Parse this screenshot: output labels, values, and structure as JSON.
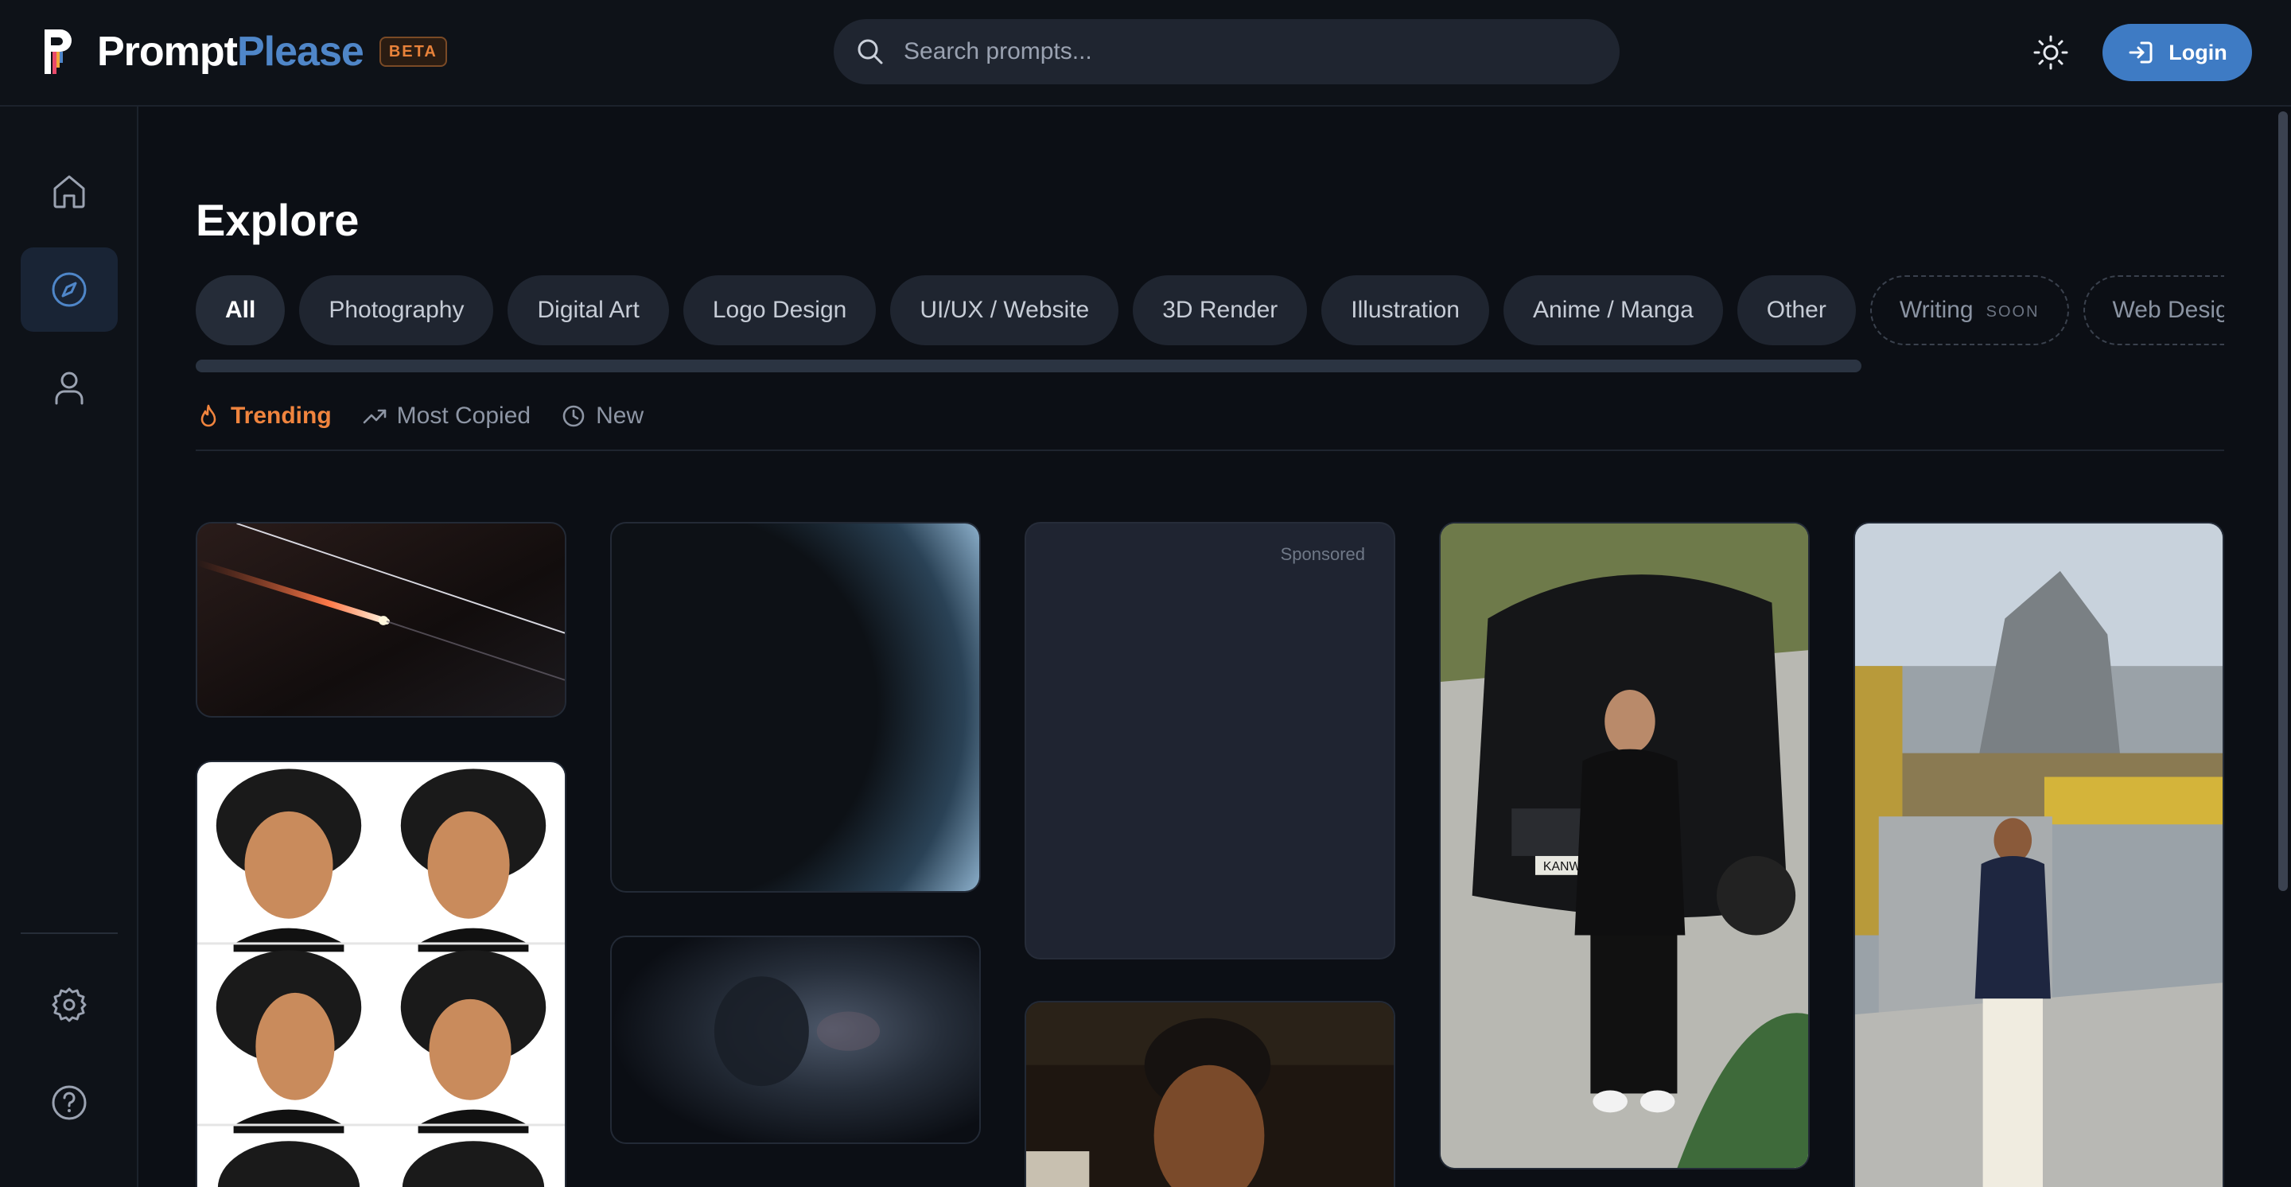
{
  "header": {
    "brand_part1": "Prompt",
    "brand_part2": "Please",
    "beta_label": "BETA",
    "search_placeholder": "Search prompts...",
    "login_label": "Login"
  },
  "sidebar": {
    "items": [
      "home-icon",
      "compass-icon",
      "user-icon"
    ],
    "bottom_items": [
      "gear-icon",
      "help-icon"
    ]
  },
  "main": {
    "title": "Explore",
    "categories": [
      {
        "label": "All",
        "active": true
      },
      {
        "label": "Photography"
      },
      {
        "label": "Digital Art"
      },
      {
        "label": "Logo Design"
      },
      {
        "label": "UI/UX / Website"
      },
      {
        "label": "3D Render"
      },
      {
        "label": "Illustration"
      },
      {
        "label": "Anime / Manga"
      },
      {
        "label": "Other"
      },
      {
        "label": "Writing",
        "soon": "SOON"
      },
      {
        "label": "Web Design"
      }
    ],
    "sort_tabs": [
      {
        "label": "Trending",
        "icon": "flame-icon",
        "active": true
      },
      {
        "label": "Most Copied",
        "icon": "trending-up-icon"
      },
      {
        "label": "New",
        "icon": "clock-icon"
      }
    ],
    "sponsored_label": "Sponsored",
    "plate_text": "KANWALIYA"
  },
  "colors": {
    "accent": "#3e7bc4",
    "trending": "#f0843e",
    "background": "#0c0f15"
  }
}
